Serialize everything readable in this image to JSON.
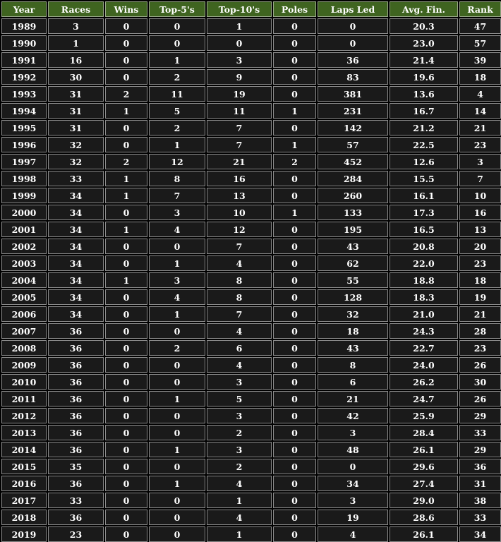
{
  "colors": {
    "header_bg": "#3f6420",
    "cell_bg": "#1a1a1a",
    "border": "#8c8c8c",
    "text": "#ffffff",
    "page_bg": "#000000"
  },
  "table": {
    "headers": [
      "Year",
      "Races",
      "Wins",
      "Top-5's",
      "Top-10's",
      "Poles",
      "Laps Led",
      "Avg. Fin.",
      "Rank"
    ],
    "rows": [
      [
        "1989",
        "3",
        "0",
        "0",
        "1",
        "0",
        "0",
        "20.3",
        "47"
      ],
      [
        "1990",
        "1",
        "0",
        "0",
        "0",
        "0",
        "0",
        "23.0",
        "57"
      ],
      [
        "1991",
        "16",
        "0",
        "1",
        "3",
        "0",
        "36",
        "21.4",
        "39"
      ],
      [
        "1992",
        "30",
        "0",
        "2",
        "9",
        "0",
        "83",
        "19.6",
        "18"
      ],
      [
        "1993",
        "31",
        "2",
        "11",
        "19",
        "0",
        "381",
        "13.6",
        "4"
      ],
      [
        "1994",
        "31",
        "1",
        "5",
        "11",
        "1",
        "231",
        "16.7",
        "14"
      ],
      [
        "1995",
        "31",
        "0",
        "2",
        "7",
        "0",
        "142",
        "21.2",
        "21"
      ],
      [
        "1996",
        "32",
        "0",
        "1",
        "7",
        "1",
        "57",
        "22.5",
        "23"
      ],
      [
        "1997",
        "32",
        "2",
        "12",
        "21",
        "2",
        "452",
        "12.6",
        "3"
      ],
      [
        "1998",
        "33",
        "1",
        "8",
        "16",
        "0",
        "284",
        "15.5",
        "7"
      ],
      [
        "1999",
        "34",
        "1",
        "7",
        "13",
        "0",
        "260",
        "16.1",
        "10"
      ],
      [
        "2000",
        "34",
        "0",
        "3",
        "10",
        "1",
        "133",
        "17.3",
        "16"
      ],
      [
        "2001",
        "34",
        "1",
        "4",
        "12",
        "0",
        "195",
        "16.5",
        "13"
      ],
      [
        "2002",
        "34",
        "0",
        "0",
        "7",
        "0",
        "43",
        "20.8",
        "20"
      ],
      [
        "2003",
        "34",
        "0",
        "1",
        "4",
        "0",
        "62",
        "22.0",
        "23"
      ],
      [
        "2004",
        "34",
        "1",
        "3",
        "8",
        "0",
        "55",
        "18.8",
        "18"
      ],
      [
        "2005",
        "34",
        "0",
        "4",
        "8",
        "0",
        "128",
        "18.3",
        "19"
      ],
      [
        "2006",
        "34",
        "0",
        "1",
        "7",
        "0",
        "32",
        "21.0",
        "21"
      ],
      [
        "2007",
        "36",
        "0",
        "0",
        "4",
        "0",
        "18",
        "24.3",
        "28"
      ],
      [
        "2008",
        "36",
        "0",
        "2",
        "6",
        "0",
        "43",
        "22.7",
        "23"
      ],
      [
        "2009",
        "36",
        "0",
        "0",
        "4",
        "0",
        "8",
        "24.0",
        "26"
      ],
      [
        "2010",
        "36",
        "0",
        "0",
        "3",
        "0",
        "6",
        "26.2",
        "30"
      ],
      [
        "2011",
        "36",
        "0",
        "1",
        "5",
        "0",
        "21",
        "24.7",
        "26"
      ],
      [
        "2012",
        "36",
        "0",
        "0",
        "3",
        "0",
        "42",
        "25.9",
        "29"
      ],
      [
        "2013",
        "36",
        "0",
        "0",
        "2",
        "0",
        "3",
        "28.4",
        "33"
      ],
      [
        "2014",
        "36",
        "0",
        "1",
        "3",
        "0",
        "48",
        "26.1",
        "29"
      ],
      [
        "2015",
        "35",
        "0",
        "0",
        "2",
        "0",
        "0",
        "29.6",
        "36"
      ],
      [
        "2016",
        "36",
        "0",
        "1",
        "4",
        "0",
        "34",
        "27.4",
        "31"
      ],
      [
        "2017",
        "33",
        "0",
        "0",
        "1",
        "0",
        "3",
        "29.0",
        "38"
      ],
      [
        "2018",
        "36",
        "0",
        "0",
        "4",
        "0",
        "19",
        "28.6",
        "33"
      ],
      [
        "2019",
        "23",
        "0",
        "0",
        "1",
        "0",
        "4",
        "26.1",
        "34"
      ]
    ]
  }
}
